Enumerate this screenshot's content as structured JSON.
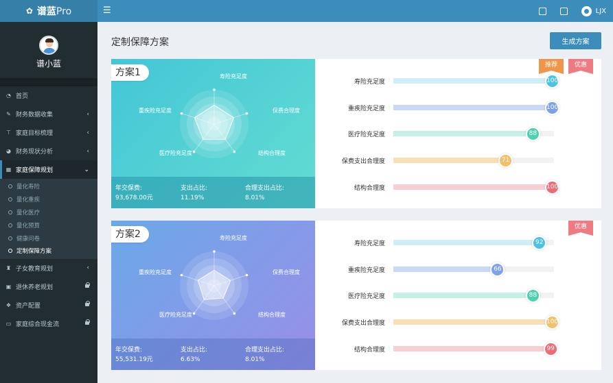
{
  "app": {
    "brand": "谱蓝",
    "brand_suffix": "Pro",
    "user": "LJX"
  },
  "sidebar": {
    "user_name": "谱小蓝",
    "items": [
      {
        "label": "首页",
        "icon": "dashboard-icon",
        "right": ""
      },
      {
        "label": "财务数据收集",
        "icon": "edit-icon",
        "right": "‹"
      },
      {
        "label": "家庭目标梳理",
        "icon": "target-icon",
        "right": "‹"
      },
      {
        "label": "财务现状分析",
        "icon": "pie-icon",
        "right": "‹"
      },
      {
        "label": "家庭保障规划",
        "icon": "grid-icon",
        "right": "⌄"
      }
    ],
    "subitems": [
      {
        "label": "量化寿险"
      },
      {
        "label": "量化重疾"
      },
      {
        "label": "量化医疗"
      },
      {
        "label": "量化预算"
      },
      {
        "label": "健康问卷"
      },
      {
        "label": "定制保障方案"
      }
    ],
    "items_after": [
      {
        "label": "子女教育规划",
        "icon": "graduation-icon",
        "right": "‹"
      },
      {
        "label": "退休养老规划",
        "icon": "calendar-icon",
        "right": "lock"
      },
      {
        "label": "资产配置",
        "icon": "cubes-icon",
        "right": "lock"
      },
      {
        "label": "家庭综合现金流",
        "icon": "money-icon",
        "right": "lock"
      }
    ]
  },
  "page": {
    "title": "定制保障方案",
    "generate_button": "生成方案"
  },
  "radar_axes": [
    "寿险充足度",
    "保费合理度",
    "结构合理度",
    "医疗险充足度",
    "重疾险充足度"
  ],
  "plans": [
    {
      "name": "方案1",
      "badges": [
        {
          "label": "推荐",
          "color": "#f0964a"
        },
        {
          "label": "优惠",
          "color": "#ef7b82"
        }
      ],
      "foot": [
        {
          "label": "年交保费:",
          "value": "93,678.00元"
        },
        {
          "label": "支出占比:",
          "value": "11.19%"
        },
        {
          "label": "合理支出占比:",
          "value": "8.01%"
        }
      ],
      "bars": [
        {
          "label": "寿险充足度",
          "value": 100,
          "track_color": "#cfeef8",
          "dot_color": "#4cc3e3"
        },
        {
          "label": "重疾险充足度",
          "value": 100,
          "track_color": "#c9d9f6",
          "dot_color": "#7ca2ea"
        },
        {
          "label": "医疗险充足度",
          "value": 88,
          "track_color": "#c5f0e5",
          "dot_color": "#4fd1b1"
        },
        {
          "label": "保费支出合理度",
          "value": 71,
          "track_color": "#f9dfb8",
          "dot_color": "#f1c06b"
        },
        {
          "label": "结构合理度",
          "value": 100,
          "track_color": "#f8cfd2",
          "dot_color": "#ec6d75"
        }
      ]
    },
    {
      "name": "方案2",
      "badges": [
        {
          "label": "优惠",
          "color": "#ef7b82"
        }
      ],
      "foot": [
        {
          "label": "年交保费:",
          "value": "55,531.19元"
        },
        {
          "label": "支出占比:",
          "value": "6.63%"
        },
        {
          "label": "合理支出占比:",
          "value": "8.01%"
        }
      ],
      "bars": [
        {
          "label": "寿险充足度",
          "value": 92,
          "track_color": "#cfeef8",
          "dot_color": "#4cc3e3"
        },
        {
          "label": "重疾险充足度",
          "value": 66,
          "track_color": "#c9d9f6",
          "dot_color": "#7ca2ea"
        },
        {
          "label": "医疗险充足度",
          "value": 88,
          "track_color": "#c5f0e5",
          "dot_color": "#4fd1b1"
        },
        {
          "label": "保费支出合理度",
          "value": 100,
          "track_color": "#f9dfb8",
          "dot_color": "#f1c06b"
        },
        {
          "label": "结构合理度",
          "value": 99,
          "track_color": "#f8cfd2",
          "dot_color": "#ec6d75"
        }
      ]
    }
  ]
}
